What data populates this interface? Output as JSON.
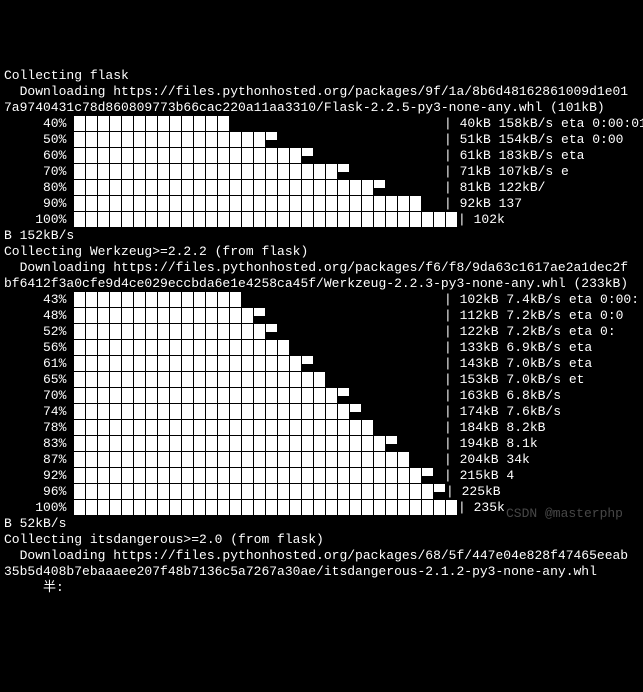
{
  "lines_top": [
    "Collecting flask",
    "  Downloading https://files.pythonhosted.org/packages/9f/1a/8b6d48162861009d1e01",
    "7a9740431c78d860809773b66cac220a11aa3310/Flask-2.2.5-py3-none-any.whl (101kB)"
  ],
  "flask_progress": [
    {
      "pct": "40%",
      "blocks": 13,
      "half": 0,
      "status": "| 40kB 158kB/s eta 0:00:01"
    },
    {
      "pct": "50%",
      "blocks": 16,
      "half": 1,
      "status": "| 51kB 154kB/s eta 0:00"
    },
    {
      "pct": "60%",
      "blocks": 19,
      "half": 1,
      "status": "| 61kB 183kB/s eta "
    },
    {
      "pct": "70%",
      "blocks": 22,
      "half": 1,
      "status": "| 71kB 107kB/s e"
    },
    {
      "pct": "80%",
      "blocks": 25,
      "half": 1,
      "status": "| 81kB 122kB/"
    },
    {
      "pct": "90%",
      "blocks": 29,
      "half": 0,
      "status": "| 92kB 137"
    },
    {
      "pct": "100%",
      "blocks": 32,
      "half": 0,
      "status": "| 102k"
    }
  ],
  "flask_tail": "B 152kB/s",
  "lines_mid": [
    "Collecting Werkzeug>=2.2.2 (from flask)",
    "  Downloading https://files.pythonhosted.org/packages/f6/f8/9da63c1617ae2a1dec2f",
    "bf6412f3a0cfe9d4ce029eccbda6e1e4258ca45f/Werkzeug-2.2.3-py3-none-any.whl (233kB)",
    ""
  ],
  "werkzeug_progress": [
    {
      "pct": "43%",
      "blocks": 14,
      "half": 0,
      "status": "| 102kB 7.4kB/s eta 0:00:"
    },
    {
      "pct": "48%",
      "blocks": 15,
      "half": 1,
      "status": "| 112kB 7.2kB/s eta 0:0"
    },
    {
      "pct": "52%",
      "blocks": 16,
      "half": 1,
      "status": "| 122kB 7.2kB/s eta 0:"
    },
    {
      "pct": "56%",
      "blocks": 18,
      "half": 0,
      "status": "| 133kB 6.9kB/s eta "
    },
    {
      "pct": "61%",
      "blocks": 19,
      "half": 1,
      "status": "| 143kB 7.0kB/s eta"
    },
    {
      "pct": "65%",
      "blocks": 21,
      "half": 0,
      "status": "| 153kB 7.0kB/s et"
    },
    {
      "pct": "70%",
      "blocks": 22,
      "half": 1,
      "status": "| 163kB 6.8kB/s "
    },
    {
      "pct": "74%",
      "blocks": 23,
      "half": 1,
      "status": "| 174kB 7.6kB/s"
    },
    {
      "pct": "78%",
      "blocks": 25,
      "half": 0,
      "status": "| 184kB 8.2kB"
    },
    {
      "pct": "83%",
      "blocks": 26,
      "half": 1,
      "status": "| 194kB 8.1k"
    },
    {
      "pct": "87%",
      "blocks": 28,
      "half": 0,
      "status": "| 204kB 34k"
    },
    {
      "pct": "92%",
      "blocks": 29,
      "half": 1,
      "status": "| 215kB 4"
    },
    {
      "pct": "96%",
      "blocks": 30,
      "half": 1,
      "status": "| 225kB "
    },
    {
      "pct": "100%",
      "blocks": 32,
      "half": 0,
      "status": "| 235k"
    }
  ],
  "werkzeug_tail": "B 52kB/s",
  "lines_bottom": [
    "Collecting itsdangerous>=2.0 (from flask)",
    "  Downloading https://files.pythonhosted.org/packages/68/5f/447e04e828f47465eeab",
    "35b5d408b7ebaaaee207f48b7136c5a7267a30ae/itsdangerous-2.1.2-py3-none-any.whl",
    "     半:"
  ],
  "watermark": "CSDN @masterphp"
}
